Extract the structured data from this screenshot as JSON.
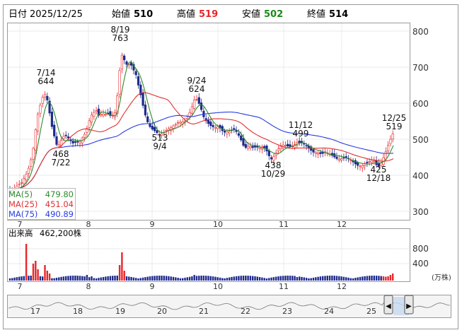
{
  "header": {
    "date_label": "日付",
    "date_value": "2025/12/25",
    "open_label": "始値",
    "open_value": "510",
    "high_label": "高値",
    "high_value": "519",
    "low_label": "安値",
    "low_value": "502",
    "close_label": "終値",
    "close_value": "514"
  },
  "colors": {
    "up": "#e8262a",
    "down": "#1f2a8c",
    "ma5": "#2e8b2e",
    "ma25": "#e03030",
    "ma75": "#2a3be0",
    "grid": "#c8c8c8",
    "volume": "#1f2a8c",
    "volume_up": "#e8262a"
  },
  "legend": {
    "ma5_label": "MA(5)",
    "ma5_value": "479.80",
    "ma25_label": "MA(25)",
    "ma25_value": "451.04",
    "ma75_label": "MA(75)",
    "ma75_value": "490.89"
  },
  "volume_panel": {
    "label": "出来高",
    "value": "462,200株",
    "unit": "(万株)",
    "ticks": [
      "800",
      "400"
    ]
  },
  "navigator": {
    "ticks": [
      "17",
      "18",
      "19",
      "20",
      "21",
      "22",
      "23",
      "24",
      "25"
    ],
    "scroll_left_icon": "◀",
    "scroll_right_icon": "▶"
  },
  "chart_data": {
    "type": "candlestick",
    "y_ticks": [
      "800",
      "700",
      "600",
      "500",
      "400",
      "300"
    ],
    "ylim": [
      280,
      820
    ],
    "x_month_labels": [
      "7",
      "8",
      "9",
      "10",
      "11",
      "12"
    ],
    "annotations": [
      {
        "date": "8/19",
        "value": "763"
      },
      {
        "date": "7/14",
        "value": "644"
      },
      {
        "date": "9/24",
        "value": "624"
      },
      {
        "date": "11/12",
        "value": "499"
      },
      {
        "date": "12/25",
        "value": "519"
      },
      {
        "date": "7/22",
        "value": "468"
      },
      {
        "date": "9/4",
        "value": "513"
      },
      {
        "date": "10/29",
        "value": "438"
      },
      {
        "date": "12/18",
        "value": "425"
      }
    ],
    "series": [
      {
        "name": "MA(5)",
        "last": 479.8
      },
      {
        "name": "MA(25)",
        "last": 451.04
      },
      {
        "name": "MA(75)",
        "last": 490.89
      }
    ]
  }
}
